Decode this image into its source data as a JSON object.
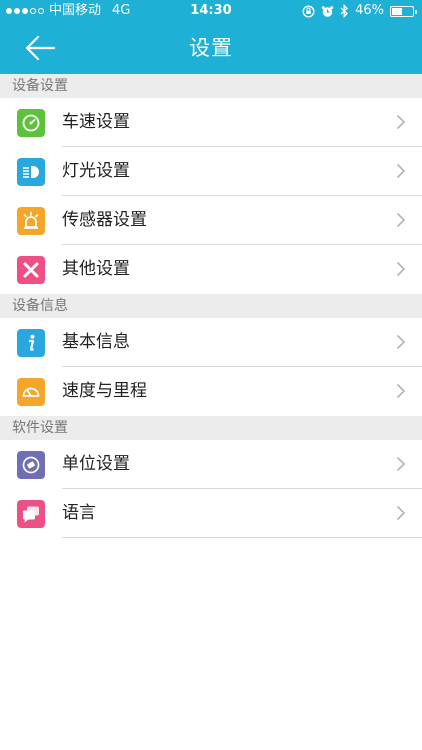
{
  "status_bar": {
    "carrier": "中国移动",
    "network": "4G",
    "time": "14:30",
    "battery_percent": "46%",
    "battery_level": 0.46
  },
  "nav": {
    "title": "设置",
    "back_icon": "arrow-left-icon"
  },
  "colors": {
    "header": "#1fb0d6",
    "green": "#5cc23a",
    "blue": "#29a8e0",
    "orange": "#f4a62a",
    "pink": "#ee4f86",
    "purple": "#6f6fb5"
  },
  "sections": [
    {
      "title": "设备设置",
      "items": [
        {
          "label": "车速设置",
          "icon": "speedometer-icon"
        },
        {
          "label": "灯光设置",
          "icon": "headlight-icon"
        },
        {
          "label": "传感器设置",
          "icon": "sensor-alarm-icon"
        },
        {
          "label": "其他设置",
          "icon": "tools-icon"
        }
      ]
    },
    {
      "title": "设备信息",
      "items": [
        {
          "label": "基本信息",
          "icon": "info-icon"
        },
        {
          "label": "速度与里程",
          "icon": "gauge-icon"
        }
      ]
    },
    {
      "title": "软件设置",
      "items": [
        {
          "label": "单位设置",
          "icon": "unit-icon"
        },
        {
          "label": "语言",
          "icon": "chat-bubbles-icon"
        }
      ]
    }
  ]
}
